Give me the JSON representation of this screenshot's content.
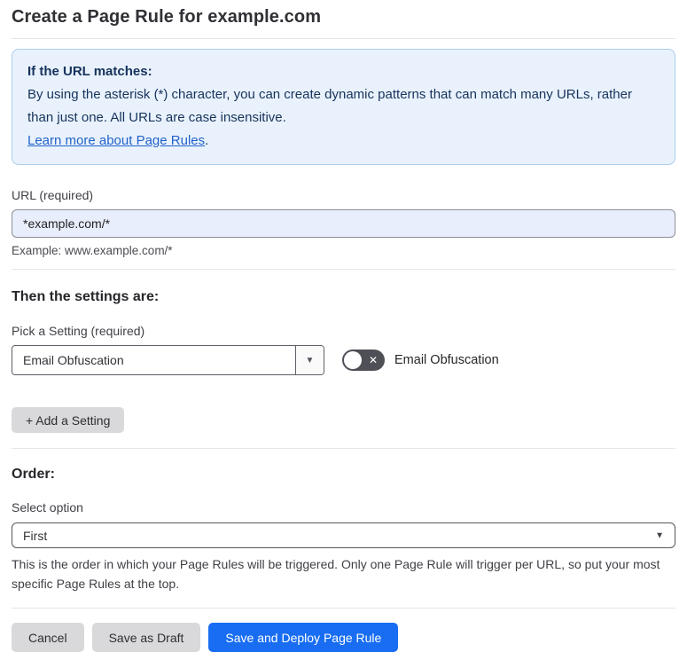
{
  "page": {
    "title": "Create a Page Rule for example.com"
  },
  "info_box": {
    "heading": "If the URL matches:",
    "body": "By using the asterisk (*) character, you can create dynamic patterns that can match many URLs, rather than just one. All URLs are case insensitive.",
    "link_text": "Learn more about Page Rules",
    "link_suffix": "."
  },
  "url_section": {
    "label": "URL (required)",
    "input_value": "*example.com/*",
    "example": "Example: www.example.com/*"
  },
  "settings_section": {
    "heading": "Then the settings are:",
    "pick_label": "Pick a Setting (required)",
    "selected_setting": "Email Obfuscation",
    "toggle_state": "off",
    "toggle_label": "Email Obfuscation",
    "add_button_label": "+ Add a Setting"
  },
  "order_section": {
    "heading": "Order:",
    "select_label": "Select option",
    "selected_option": "First",
    "help_text": "This is the order in which your Page Rules will be triggered. Only one Page Rule will trigger per URL, so put your most specific Page Rules at the top."
  },
  "footer": {
    "cancel_label": "Cancel",
    "save_draft_label": "Save as Draft",
    "save_deploy_label": "Save and Deploy Page Rule"
  },
  "icons": {
    "dropdown_caret": "▼",
    "toggle_off": "✕"
  },
  "colors": {
    "accent_blue": "#186df2",
    "info_box_bg": "#e9f2fc",
    "info_box_border": "#a9cdee",
    "info_text": "#16325c",
    "link_blue": "#2262c9",
    "url_input_bg": "#e9eefc",
    "toggle_bg": "#4f4f57",
    "gray_button_bg": "#d9d9dc"
  }
}
